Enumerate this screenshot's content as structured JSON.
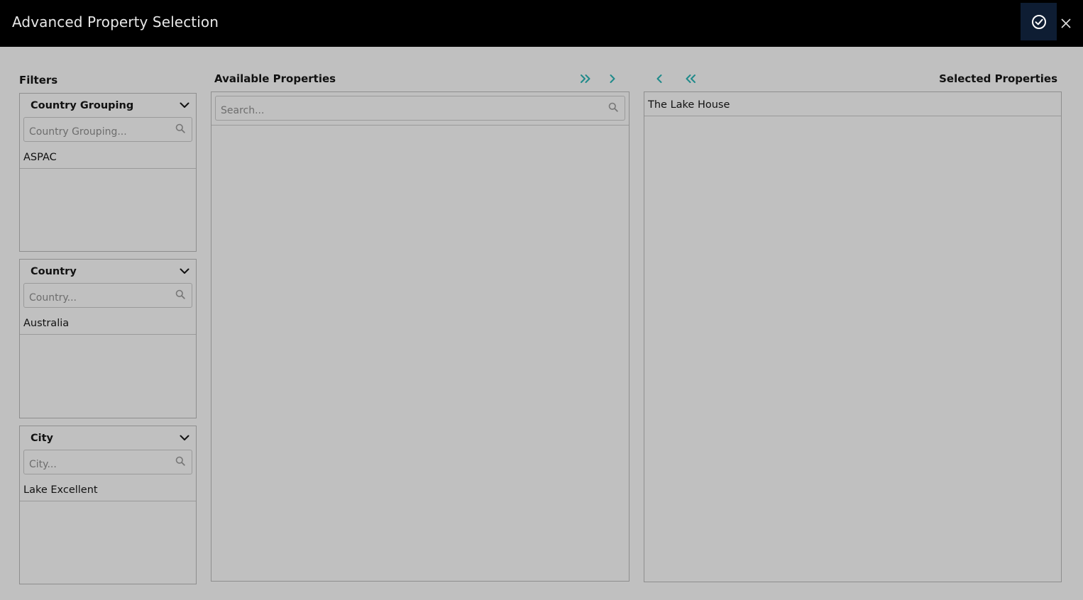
{
  "window": {
    "title": "Advanced Property Selection"
  },
  "filters": {
    "label": "Filters",
    "groups": [
      {
        "label": "Country Grouping",
        "placeholder": "Country Grouping...",
        "items": [
          "ASPAC"
        ]
      },
      {
        "label": "Country",
        "placeholder": "Country...",
        "items": [
          "Australia"
        ]
      },
      {
        "label": "City",
        "placeholder": "City...",
        "items": [
          "Lake Excellent"
        ]
      }
    ]
  },
  "available": {
    "label": "Available Properties",
    "placeholder": "Search..."
  },
  "selected": {
    "label": "Selected Properties",
    "items": [
      "The Lake House"
    ]
  },
  "icons": {
    "confirm": "check-circle-icon",
    "close": "close-icon",
    "move_all_right": "double-chevron-right-icon",
    "move_right": "chevron-right-icon",
    "move_left": "chevron-left-icon",
    "move_all_left": "double-chevron-left-icon"
  },
  "colors": {
    "accent": "#1f8a8a",
    "background": "#c0c0c0",
    "titlebar": "#000000",
    "confirm_bg": "#0e1d33"
  }
}
